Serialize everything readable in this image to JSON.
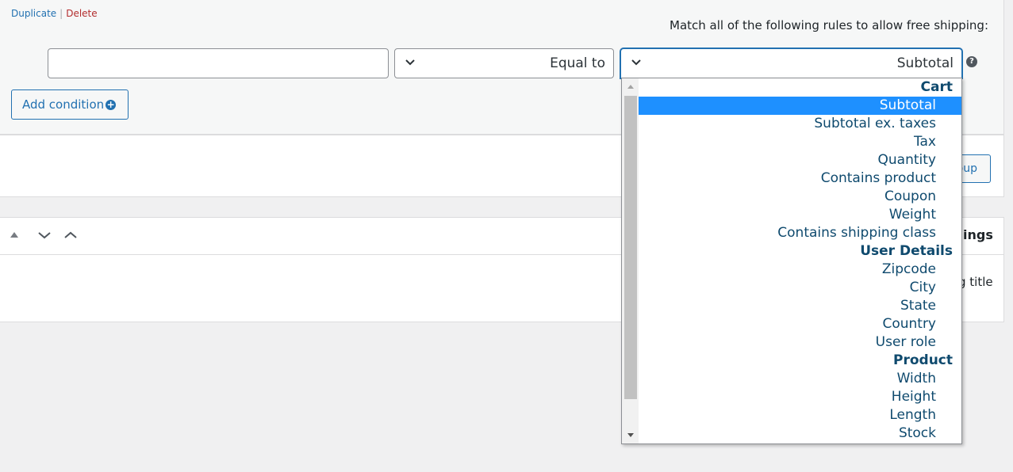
{
  "row_actions": {
    "duplicate": "Duplicate",
    "separator": "|",
    "delete": "Delete"
  },
  "match_text": ":Match all of the following rules to allow free shipping",
  "value_input": {
    "value": ""
  },
  "operator_select": {
    "selected": "Equal to"
  },
  "condition_select": {
    "selected": "Subtotal"
  },
  "help_icon": "?",
  "add_condition": {
    "label": "Add condition",
    "icon": "plus-circle-icon"
  },
  "add_group": {
    "label_partial": "oup"
  },
  "settings": {
    "title_partial": "ings",
    "title_label_partial": "g title"
  },
  "dropdown": {
    "groups": [
      {
        "label": "Cart",
        "options": [
          "Subtotal",
          "Subtotal ex. taxes",
          "Tax",
          "Quantity",
          "Contains product",
          "Coupon",
          "Weight",
          "Contains shipping class"
        ]
      },
      {
        "label": "User Details",
        "options": [
          "Zipcode",
          "City",
          "State",
          "Country",
          "User role"
        ]
      },
      {
        "label": "Product",
        "options": [
          "Width",
          "Height",
          "Length",
          "Stock"
        ]
      }
    ],
    "selected": "Subtotal"
  },
  "colors": {
    "accent": "#2271b1",
    "highlight": "#1e90ff",
    "delete": "#b32d2e"
  }
}
